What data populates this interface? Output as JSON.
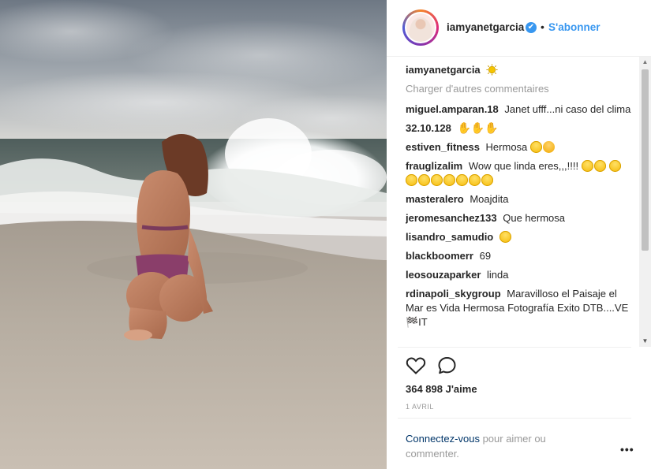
{
  "post": {
    "owner": "iamyanetgarcia",
    "follow_label": "S'abonner",
    "separator": "•",
    "verified_glyph": "✔",
    "caption_user": "iamyanetgarcia",
    "load_more": "Charger d'autres commentaires",
    "likes": "364 898 J'aime",
    "date": "1 avril",
    "login_link": "Connectez-vous",
    "login_rest": " pour aimer ou commenter.",
    "more_label": "•••"
  },
  "comments": [
    {
      "user": "miguel.amparan.18",
      "text": "Janet ufff...ni caso del clima"
    },
    {
      "user": "32.10.128",
      "text": "",
      "emoji": "hands"
    },
    {
      "user": "estiven_fitness",
      "text": "Hermosa",
      "emoji": "heart-eyes-wink"
    },
    {
      "user": "frauglizalim",
      "text": "Wow que linda eres,,,!!!!",
      "emoji": "smile-row"
    },
    {
      "user": "masteralero",
      "text": "Moajdita"
    },
    {
      "user": "jeromesanchez133",
      "text": "Que hermosa"
    },
    {
      "user": "lisandro_samudio",
      "text": "",
      "emoji": "heart-eyes"
    },
    {
      "user": "blackboomerr",
      "text": "69"
    },
    {
      "user": "leosouzaparker",
      "text": "linda"
    },
    {
      "user": "rdinapoli_skygroup",
      "text": "Maravilloso el Paisaje el Mar es Vida Hermosa Fotografía Exito DTB....VE🏁IT"
    }
  ],
  "icons": {
    "like": "heart-outline-icon",
    "comment": "comment-bubble-icon",
    "verified": "verified-badge-icon",
    "more": "more-options-icon"
  },
  "colors": {
    "link_blue": "#3897f0",
    "dark_link": "#003569",
    "muted": "#999999"
  }
}
